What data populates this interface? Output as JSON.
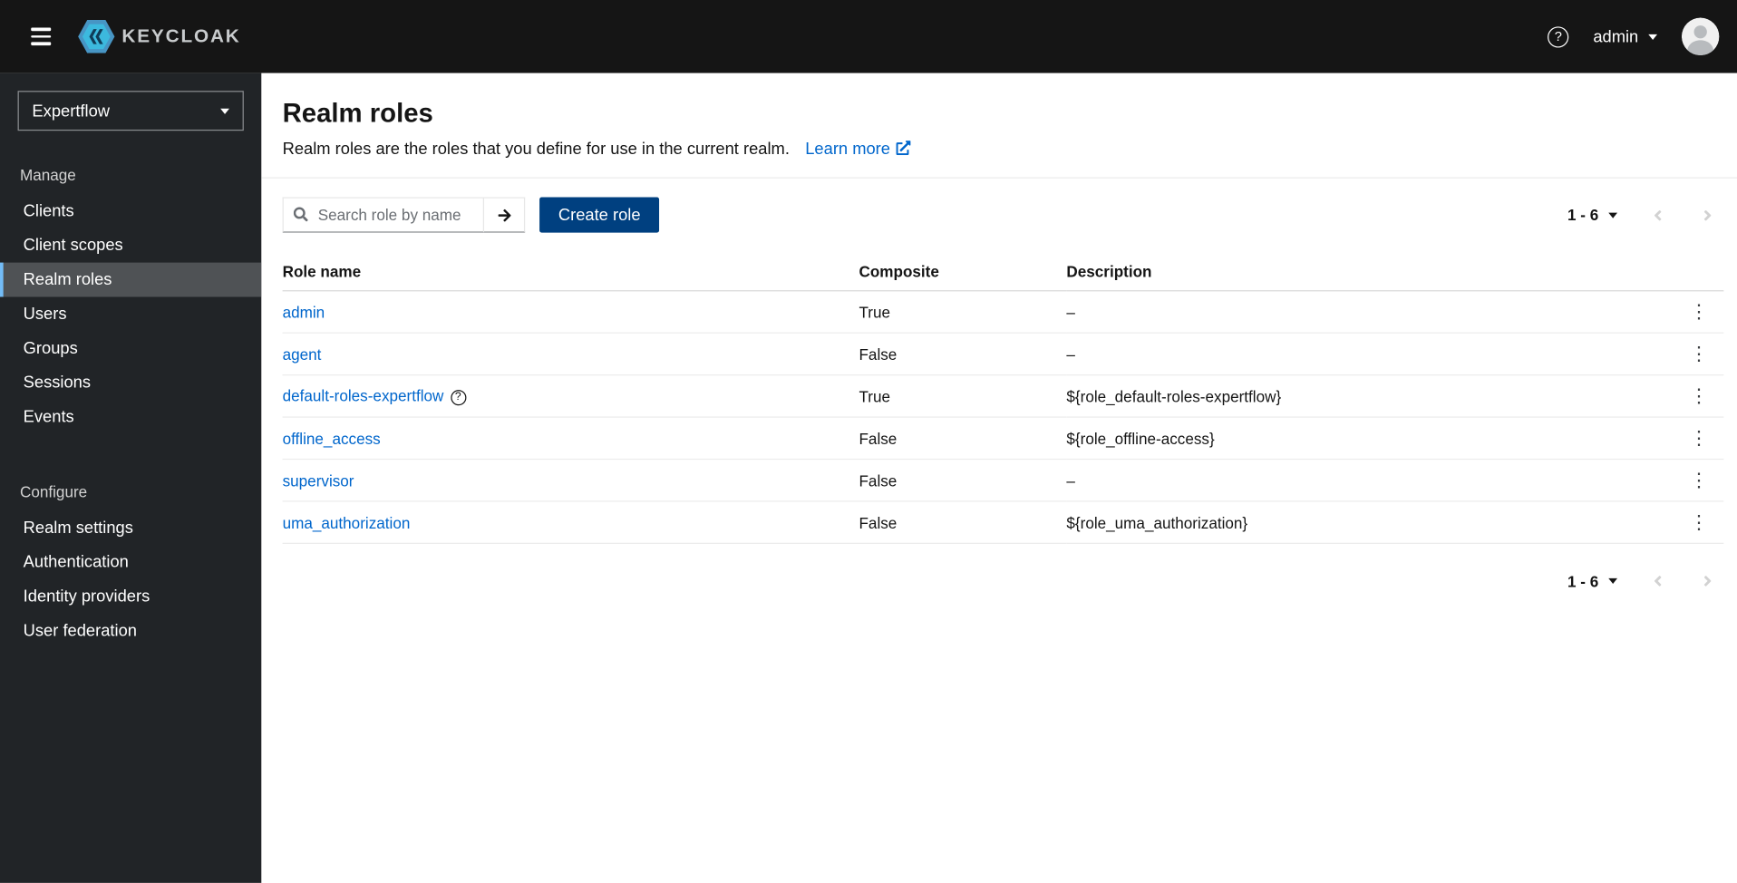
{
  "colors": {
    "accent": "#0066cc",
    "primary-button": "#004080",
    "topbar-bg": "#151515",
    "sidebar-bg": "#212427",
    "sidebar-active-bg": "#4f5255",
    "sidebar-active-border": "#73bcf7"
  },
  "icons": {
    "help": "?",
    "kebab": "⋮"
  },
  "topbar": {
    "brand": "KEYCLOAK",
    "username": "admin"
  },
  "sidebar": {
    "realm_selector": "Expertflow",
    "active_item": "Realm roles",
    "sections": [
      {
        "label": "Manage",
        "items": [
          "Clients",
          "Client scopes",
          "Realm roles",
          "Users",
          "Groups",
          "Sessions",
          "Events"
        ]
      },
      {
        "label": "Configure",
        "items": [
          "Realm settings",
          "Authentication",
          "Identity providers",
          "User federation"
        ]
      }
    ]
  },
  "page": {
    "title": "Realm roles",
    "description": "Realm roles are the roles that you define for use in the current realm.",
    "learn_more_label": "Learn more"
  },
  "toolbar": {
    "search_placeholder": "Search role by name",
    "create_button_label": "Create role",
    "pagination_range": "1 - 6"
  },
  "table": {
    "columns": [
      "Role name",
      "Composite",
      "Description"
    ],
    "rows": [
      {
        "name": "admin",
        "composite": "True",
        "description": "–"
      },
      {
        "name": "agent",
        "composite": "False",
        "description": "–"
      },
      {
        "name": "default-roles-expertflow",
        "composite": "True",
        "description": "${role_default-roles-expertflow}"
      },
      {
        "name": "offline_access",
        "composite": "False",
        "description": "${role_offline-access}"
      },
      {
        "name": "supervisor",
        "composite": "False",
        "description": "–"
      },
      {
        "name": "uma_authorization",
        "composite": "False",
        "description": "${role_uma_authorization}"
      }
    ]
  },
  "footer": {
    "pagination_range": "1 - 6"
  }
}
